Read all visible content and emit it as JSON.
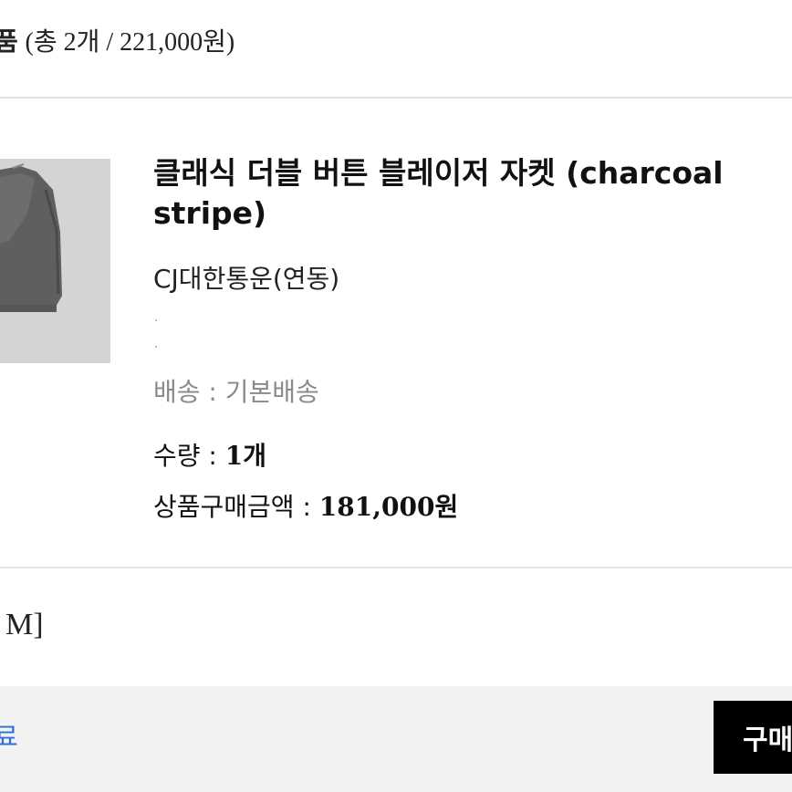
{
  "header": {
    "label_fragment": "품",
    "summary": "(총 2개 / 221,000원)"
  },
  "product": {
    "thumbnail_icon": "blazer-icon",
    "title_line1": "클래식 더블 버튼 블레이저 자켓 (charcoal",
    "title_line2": "stripe)",
    "courier": "CJ대한통운(연동)",
    "shipping": "배송 : 기본배송",
    "quantity_label": "수량 : ",
    "quantity_value": "1개",
    "price_label": "상품구매금액 : ",
    "price_value": "181,000원"
  },
  "option": {
    "text": "M]"
  },
  "bottom": {
    "cancel_fragment": "료",
    "buy_fragment": "구매"
  },
  "colors": {
    "buy_button_bg": "#000000",
    "link": "#2f6fd6",
    "muted": "#8a8a8a",
    "bar_bg": "#f2f2f2"
  }
}
